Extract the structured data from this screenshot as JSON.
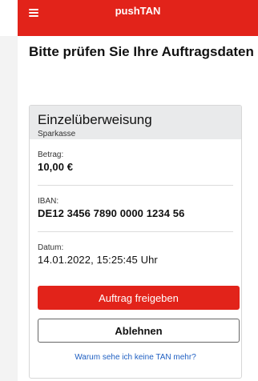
{
  "header": {
    "title": "pushTAN",
    "menu_icon": "hamburger-menu-icon",
    "background_color": "#e2231a"
  },
  "page": {
    "title": "Bitte prüfen Sie Ihre Auftragsdaten"
  },
  "order": {
    "type": "Einzelüberweisung",
    "bank": "Sparkasse",
    "fields": [
      {
        "label": "Betrag:",
        "value": "10,00 €"
      },
      {
        "label": "IBAN:",
        "value": "DE12 3456 7890 0000 1234 56"
      },
      {
        "label": "Datum:",
        "value": "14.01.2022, 15:25:45 Uhr"
      }
    ]
  },
  "actions": {
    "approve_label": "Auftrag freigeben",
    "reject_label": "Ablehnen",
    "help_link": "Warum sehe ich keine TAN mehr?"
  },
  "colors": {
    "accent": "#e2231a",
    "link": "#1f5fc2",
    "card_header": "#e9eaeb"
  }
}
